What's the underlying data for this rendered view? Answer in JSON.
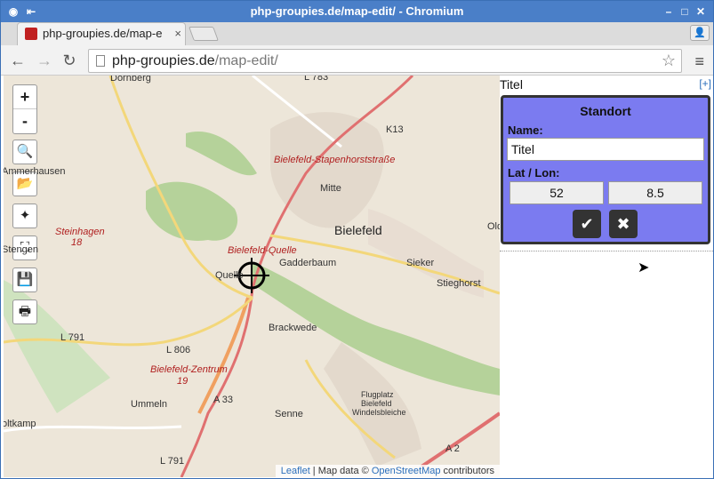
{
  "window": {
    "title": "php-groupies.de/map-edit/ - Chromium"
  },
  "tab": {
    "title": "php-groupies.de/map-e",
    "close": "×"
  },
  "address": {
    "host": "php-groupies.de",
    "path": "/map-edit/"
  },
  "map": {
    "zoom_in": "+",
    "zoom_out": "-",
    "labels": [
      {
        "t": "Dornberg",
        "c": ""
      },
      {
        "t": "Ammerhausen",
        "c": ""
      },
      {
        "t": "Steinhagen",
        "c": "red"
      },
      {
        "t": "18",
        "c": "red"
      },
      {
        "t": "Stengen",
        "c": ""
      },
      {
        "t": "Quelle",
        "c": ""
      },
      {
        "t": "Bielefeld-Quelle",
        "c": "red"
      },
      {
        "t": "Gadderbaum",
        "c": ""
      },
      {
        "t": "Mitte",
        "c": ""
      },
      {
        "t": "Bielefeld",
        "c": "big"
      },
      {
        "t": "Bielefeld-Stapenhorststraße",
        "c": "red"
      },
      {
        "t": "Sieker",
        "c": ""
      },
      {
        "t": "Stieghorst",
        "c": ""
      },
      {
        "t": "Old",
        "c": ""
      },
      {
        "t": "Brackwede",
        "c": ""
      },
      {
        "t": "L 791",
        "c": ""
      },
      {
        "t": "L 806",
        "c": ""
      },
      {
        "t": "Bielefeld-Zentrum",
        "c": "red"
      },
      {
        "t": "19",
        "c": "red"
      },
      {
        "t": "A 33",
        "c": ""
      },
      {
        "t": "Ummeln",
        "c": ""
      },
      {
        "t": "Senne",
        "c": ""
      },
      {
        "t": "Flugplatz",
        "c": ""
      },
      {
        "t": "Bielefeld",
        "c": ""
      },
      {
        "t": "Windelsbleiche",
        "c": ""
      },
      {
        "t": "A 2",
        "c": ""
      },
      {
        "t": "oltkamp",
        "c": ""
      },
      {
        "t": "L 791",
        "c": ""
      },
      {
        "t": "L 783",
        "c": ""
      },
      {
        "t": "K13",
        "c": ""
      }
    ],
    "attribution": {
      "leaflet": "Leaflet",
      "text": " | Map data © ",
      "osm": "OpenStreetMap",
      "contributors": " contributors"
    }
  },
  "panel": {
    "title": "Titel",
    "add": "[+]",
    "dialog": {
      "heading": "Standort",
      "name_label": "Name:",
      "name_value": "Titel",
      "latlon_label": "Lat / Lon:",
      "lat": "52",
      "lon": "8.5"
    }
  }
}
